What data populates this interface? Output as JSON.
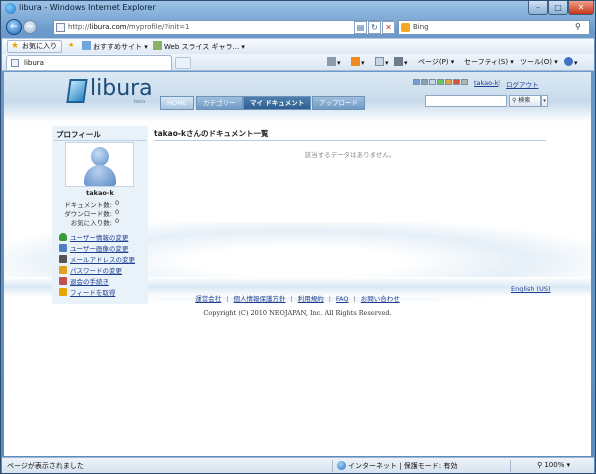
{
  "window": {
    "title": "libura - Windows Internet Explorer",
    "minimize_glyph": "–",
    "maximize_glyph": "□",
    "close_glyph": "✕"
  },
  "nav": {
    "back_glyph": "←",
    "forward_glyph": "→"
  },
  "address": {
    "prefix": "http://",
    "host": "libura.com",
    "path": "/myprofile/?init=1",
    "dropdown_glyph": "▾"
  },
  "address_tools": {
    "compat": "▤",
    "refresh": "↻",
    "stop": "✕"
  },
  "search": {
    "engine": "Bing",
    "go_glyph": "⚲"
  },
  "favorites_bar": {
    "favorites_button": "お気に入り",
    "items": [
      "おすすめサイト ▾",
      "Web スライス ギャラ... ▾"
    ]
  },
  "tab": {
    "title": "libura"
  },
  "command_bar": {
    "page": "ページ(P) ▾",
    "safety": "セーフティ(S) ▾",
    "tools": "ツール(O) ▾",
    "help": "▾"
  },
  "site": {
    "logo": "libura",
    "beta": "beta",
    "nav_tabs": [
      "HOME",
      "カテゴリー",
      "マイ ドキュメント",
      "アップロード"
    ],
    "active_tab_index": 2,
    "user_link": "takao-k",
    "logout": "ログアウト",
    "search_button": "⚲ 検索",
    "search_dropdown": "▾",
    "swatch_colors": [
      "#6fa0d8",
      "#8aa3b8",
      "#c8d8e8",
      "#6cc46c",
      "#e4a63c",
      "#d6553c",
      "#b4b4b4"
    ]
  },
  "sidebar": {
    "title": "プロフィール",
    "username": "takao-k",
    "stats": [
      {
        "label": "ドキュメント数:",
        "value": "0"
      },
      {
        "label": "ダウンロード数:",
        "value": "0"
      },
      {
        "label": "お気に入り数:",
        "value": "0"
      }
    ],
    "links": [
      {
        "label": "ユーザー情報の変更",
        "icon": "user-icon",
        "color": "#3a9a3a"
      },
      {
        "label": "ユーザー画像の変更",
        "icon": "image-icon",
        "color": "#4f7fc0"
      },
      {
        "label": "メールアドレスの変更",
        "icon": "mail-icon",
        "color": "#555555"
      },
      {
        "label": "パスワードの変更",
        "icon": "key-icon",
        "color": "#e0a020"
      },
      {
        "label": "退会の手続き",
        "icon": "leave-icon",
        "color": "#c05050"
      },
      {
        "label": "フィードを取得",
        "icon": "feed-icon",
        "color": "#e8a400"
      }
    ]
  },
  "main": {
    "heading": "takao-kさんのドキュメント一覧",
    "empty_message": "該当するデータはありません。"
  },
  "footer": {
    "language": "English (US)",
    "links": [
      "運営会社",
      "個人情報保護方針",
      "利用規約",
      "FAQ",
      "お問い合わせ"
    ],
    "copyright": "Copyright (C) 2010 NEOJAPAN, Inc. All Rights Reserved."
  },
  "statusbar": {
    "text": "ページが表示されました",
    "zone": "インターネット | 保護モード: 有効",
    "zoom": "⚲ 100% ▾"
  }
}
